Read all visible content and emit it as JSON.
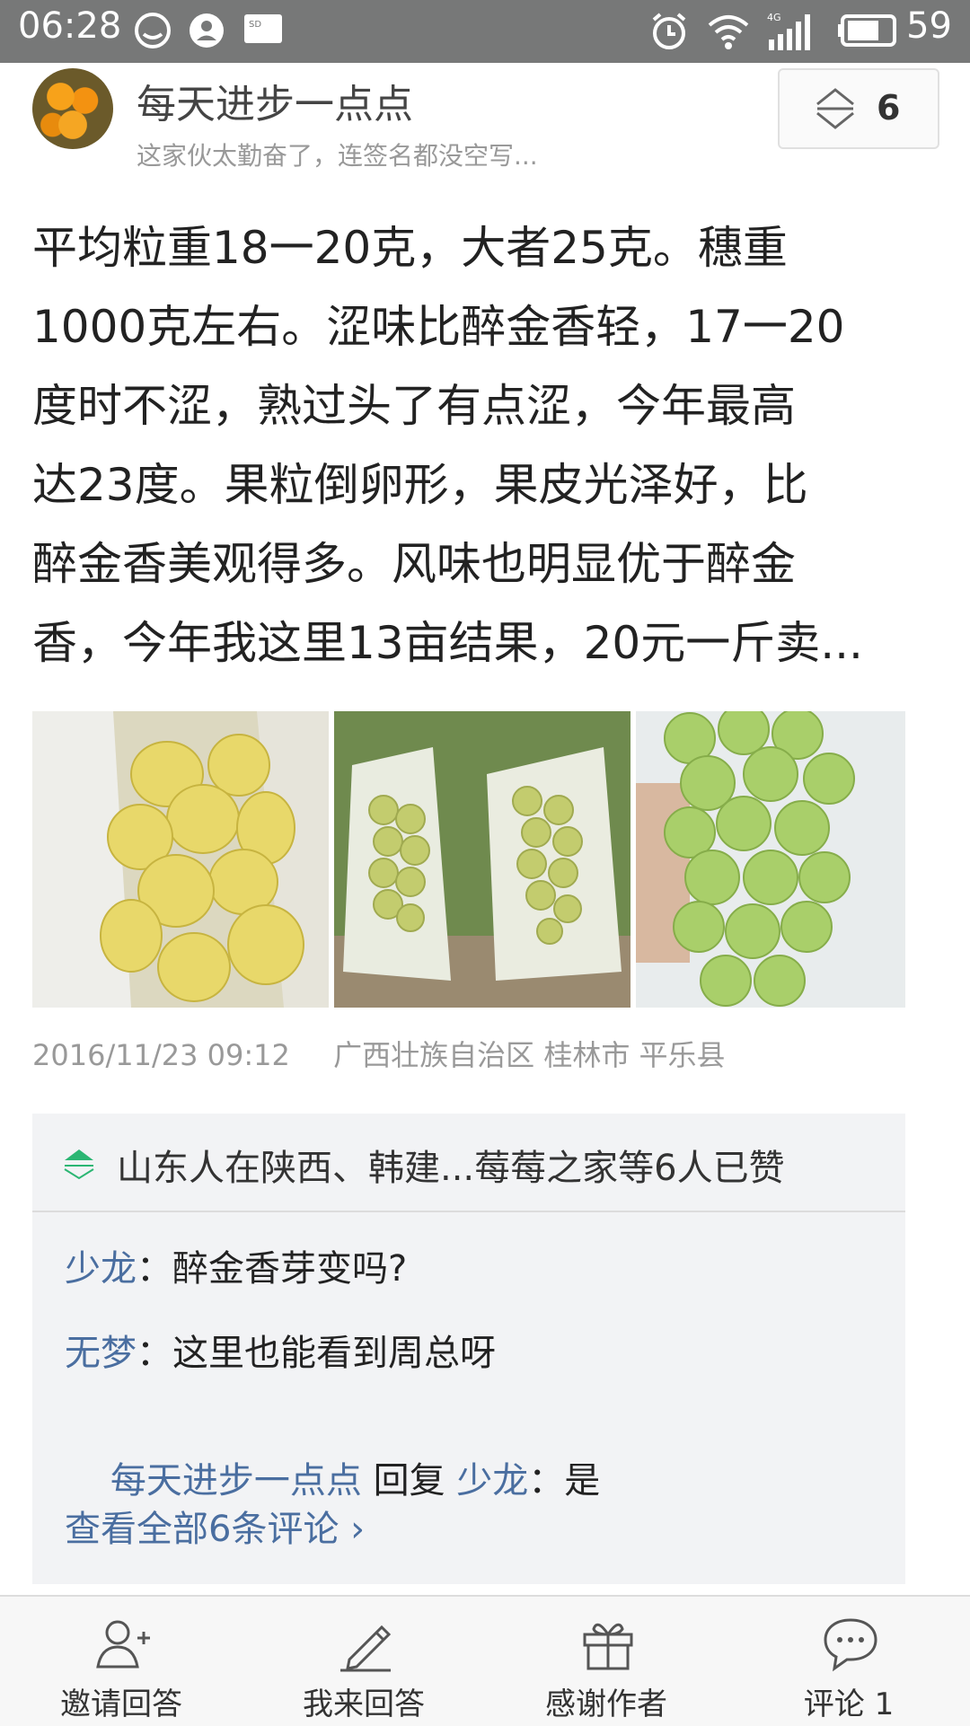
{
  "status_bar": {
    "time": "06:28",
    "network": "4G",
    "battery": "59"
  },
  "post": {
    "username": "每天进步一点点",
    "signature": "这家伙太勤奋了，连签名都没空写...",
    "vote_count": "6",
    "content_lines": [
      "平均粒重18一20克，大者25克。穗重",
      "1000克左右。涩味比醉金香轻，17一20",
      "度时不涩，熟过头了有点涩，今年最高",
      "达23度。果粒倒卵形，果皮光泽好，比",
      "醉金香美观得多。风味也明显优于醉金",
      "香，今年我这里13亩结果，20元一斤卖..."
    ],
    "images": [
      {
        "name": "grape-photo-1"
      },
      {
        "name": "grape-photo-2"
      },
      {
        "name": "grape-photo-3"
      }
    ],
    "timestamp": "2016/11/23 09:12",
    "location": "广西壮族自治区 桂林市 平乐县"
  },
  "likes": {
    "text": "山东人在陕西、韩建...莓莓之家等6人已赞"
  },
  "comments": [
    {
      "author": "少龙",
      "sep": "：",
      "text": "醉金香芽变吗?"
    },
    {
      "author": "无梦",
      "sep": "：",
      "text": "这里也能看到周总呀"
    },
    {
      "author": "每天进步一点点",
      "reply_word": " 回复 ",
      "reply_to": "少龙",
      "sep": "：",
      "text": "是"
    }
  ],
  "view_all": "查看全部6条评论 ›",
  "bottom_bar": {
    "tabs": [
      {
        "label": "邀请回答",
        "icon": "invite-user-icon"
      },
      {
        "label": "我来回答",
        "icon": "pen-icon"
      },
      {
        "label": "感谢作者",
        "icon": "gift-icon"
      },
      {
        "label": "评论 1",
        "icon": "comment-bubble-icon"
      }
    ]
  },
  "colors": {
    "status_bar": "#777878",
    "link": "#4a6ea0",
    "accent_green": "#2bb673"
  }
}
